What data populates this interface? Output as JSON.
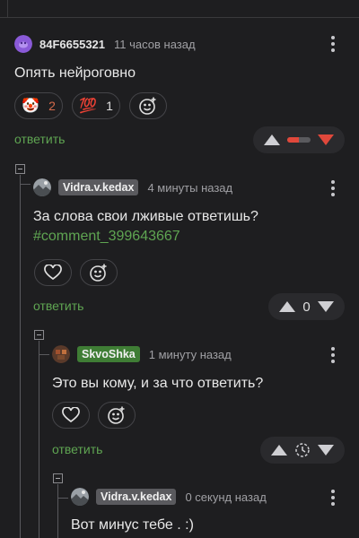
{
  "colors": {
    "background": "#1e1e20",
    "accent_green": "#5fa552",
    "downvote_red": "#e0483b",
    "badge_green": "#3f7d35",
    "badge_gray": "#5a5a5e"
  },
  "comments": [
    {
      "author": "84F6655321",
      "avatar_icon": "purple-avatar-icon",
      "time": "11 часов назад",
      "text": "Опять нейроговно",
      "reactions": [
        {
          "emoji": "🤡",
          "icon": "clown-face-icon",
          "count": "2"
        },
        {
          "emoji": "💯",
          "icon": "hundred-points-icon",
          "count": "1"
        }
      ],
      "reply_label": "ответить",
      "rating": {
        "display": "bar",
        "negative_fraction": 0.5,
        "downvoted": true
      }
    },
    {
      "author": "Vidra.v.kedax",
      "avatar_icon": "landscape-avatar-icon",
      "time": "4 минуты назад",
      "text": "За слова свои лживые ответишь?",
      "link": "#comment_399643667",
      "reply_label": "ответить",
      "rating": {
        "score": "0"
      }
    },
    {
      "author": "SkvoShka",
      "avatar_icon": "pixel-avatar-icon",
      "time": "1 минуту назад",
      "text": "Это вы кому, и за что ответить?",
      "reply_label": "ответить",
      "rating": {
        "display": "pending-timer"
      }
    },
    {
      "author": "Vidra.v.kedax",
      "avatar_icon": "landscape-avatar-icon",
      "time": "0 секунд назад",
      "text": "Вот минус тебе . :)"
    }
  ]
}
